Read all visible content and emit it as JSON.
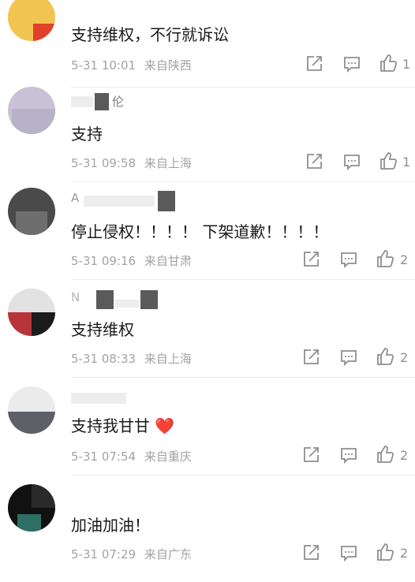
{
  "comments": [
    {
      "username": "",
      "text": "支持维权，不行就诉讼",
      "date": "5-31",
      "time": "10:01",
      "location": "来自陕西",
      "likes": "1"
    },
    {
      "username": "伦",
      "text": "支持",
      "date": "5-31",
      "time": "09:58",
      "location": "来自上海",
      "likes": "1"
    },
    {
      "username": "A",
      "text": "停止侵权！！！！ 下架道歉！！！！",
      "date": "5-31",
      "time": "09:16",
      "location": "来自甘肃",
      "likes": "2"
    },
    {
      "username": "N",
      "text": "支持维权",
      "date": "5-31",
      "time": "08:33",
      "location": "来自上海",
      "likes": "2"
    },
    {
      "username": "",
      "text": "支持我甘甘 ❤️",
      "date": "5-31",
      "time": "07:54",
      "location": "来自重庆",
      "likes": "2"
    },
    {
      "username": "",
      "text": "加油加油！",
      "date": "5-31",
      "time": "07:29",
      "location": "来自广东",
      "likes": "2"
    }
  ],
  "icons": {
    "repost": "repost-icon",
    "reply": "comment-icon",
    "like": "thumbs-up-icon"
  },
  "colors": {
    "text": "#1a1a1a",
    "meta": "#a3a3a3",
    "icon": "#8f8f8f",
    "heart": "#e8413b"
  }
}
